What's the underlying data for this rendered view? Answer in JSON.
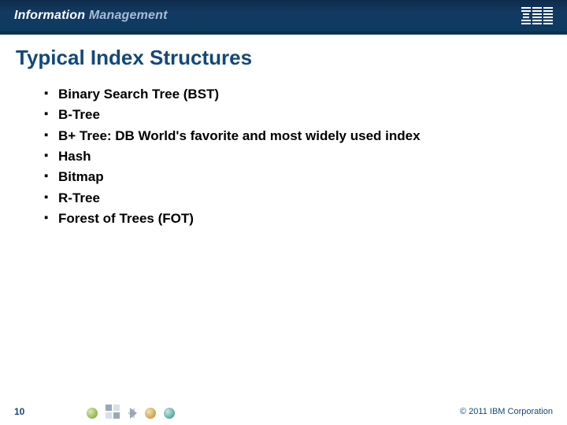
{
  "banner": {
    "brand_prefix": "Information",
    "brand_suffix": "Management",
    "logo_label": "IBM"
  },
  "title": "Typical Index Structures",
  "bullets": [
    "Binary Search Tree (BST)",
    "B-Tree",
    "B+ Tree: DB World's favorite and most widely used index",
    "Hash",
    "Bitmap",
    "R-Tree",
    "Forest of Trees (FOT)"
  ],
  "footer": {
    "page_number": "10",
    "copyright": "© 2011 IBM Corporation"
  }
}
